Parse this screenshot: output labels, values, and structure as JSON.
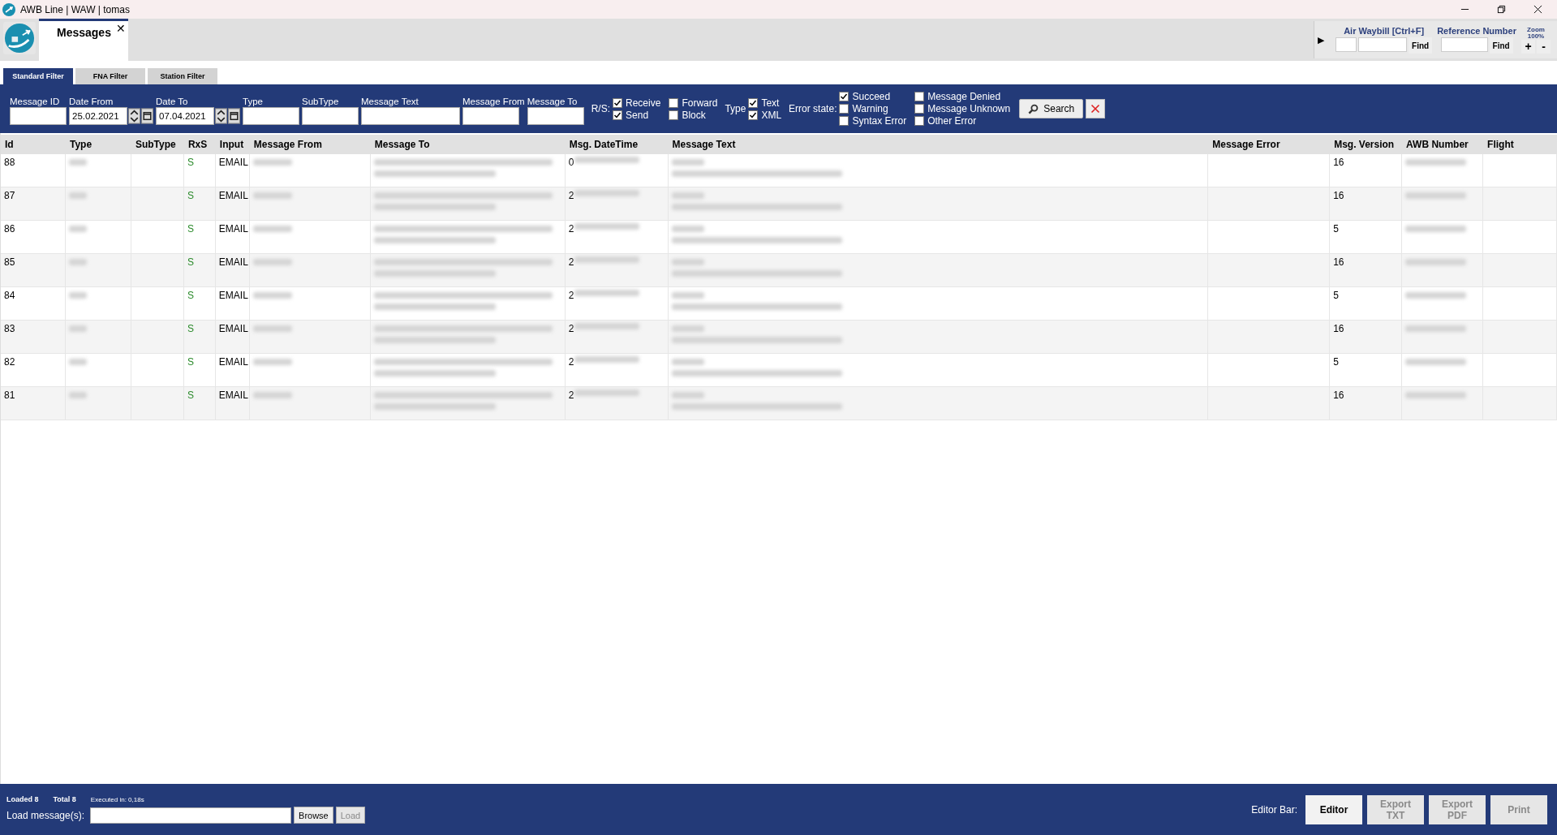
{
  "window": {
    "title": "AWB Line | WAW | tomas"
  },
  "doc_tabs": [
    {
      "label": "Messages",
      "close": "✕",
      "selected": true
    }
  ],
  "quick_search": {
    "expand": "▶",
    "awb_label": "Air Waybill [Ctrl+F]",
    "awb_find": "Find",
    "ref_label": "Reference Number",
    "ref_find": "Find",
    "zoom_label": "Zoom",
    "zoom_value": "100%",
    "zoom_in": "+",
    "zoom_out": "-"
  },
  "filter_tabs": [
    {
      "label": "Standard Filter",
      "selected": true
    },
    {
      "label": "FNA Filter",
      "selected": false
    },
    {
      "label": "Station Filter",
      "selected": false
    }
  ],
  "fields": [
    {
      "kind": "text",
      "label": "Message ID"
    },
    {
      "kind": "date",
      "label": "Date From",
      "value": "25.02.2021"
    },
    {
      "kind": "date",
      "label": "Date To",
      "value": "07.04.2021"
    },
    {
      "kind": "text",
      "label": "Type"
    },
    {
      "kind": "text",
      "label": "SubType"
    },
    {
      "kind": "wide",
      "label": "Message Text"
    },
    {
      "kind": "text",
      "label": "Message From"
    },
    {
      "kind": "text",
      "label": "Message To"
    }
  ],
  "rs": {
    "label": "R/S:",
    "options": [
      {
        "label": "Receive",
        "checked": true
      },
      {
        "label": "Send",
        "checked": true
      },
      {
        "label": "Forward",
        "checked": false
      },
      {
        "label": "Block",
        "checked": false
      }
    ]
  },
  "type_filter": {
    "label": "Type",
    "options": [
      {
        "label": "Text",
        "checked": true
      },
      {
        "label": "XML",
        "checked": true
      }
    ]
  },
  "error_state": {
    "label": "Error state:",
    "options": [
      {
        "label": "Succeed",
        "checked": true
      },
      {
        "label": "Warning",
        "checked": false
      },
      {
        "label": "Syntax Error",
        "checked": false
      },
      {
        "label": "Message Denied",
        "checked": false
      },
      {
        "label": "Message Unknown",
        "checked": false
      },
      {
        "label": "Other Error",
        "checked": false
      }
    ]
  },
  "search_button": "Search",
  "table": {
    "columns": [
      "Id",
      "Type",
      "SubType",
      "RxS",
      "Input",
      "Message From",
      "Message To",
      "Msg. DateTime",
      "Message Text",
      "Message Error",
      "Msg. Version",
      "AWB Number",
      "Flight"
    ],
    "rows": [
      {
        "id": "88",
        "rxs": "S",
        "input": "EMAIL",
        "datetime_visible": "0",
        "version": "16"
      },
      {
        "id": "87",
        "rxs": "S",
        "input": "EMAIL",
        "datetime_visible": "2",
        "version": "16"
      },
      {
        "id": "86",
        "rxs": "S",
        "input": "EMAIL",
        "datetime_visible": "2",
        "version": "5"
      },
      {
        "id": "85",
        "rxs": "S",
        "input": "EMAIL",
        "datetime_visible": "2",
        "version": "16"
      },
      {
        "id": "84",
        "rxs": "S",
        "input": "EMAIL",
        "datetime_visible": "2",
        "version": "5"
      },
      {
        "id": "83",
        "rxs": "S",
        "input": "EMAIL",
        "datetime_visible": "2",
        "version": "16"
      },
      {
        "id": "82",
        "rxs": "S",
        "input": "EMAIL",
        "datetime_visible": "2",
        "version": "5"
      },
      {
        "id": "81",
        "rxs": "S",
        "input": "EMAIL",
        "datetime_visible": "2",
        "version": "16"
      }
    ]
  },
  "status": {
    "loaded": "Loaded 8",
    "total": "Total 8",
    "executed": "Executed in: 0,18s",
    "load_label": "Load message(s):",
    "browse": "Browse",
    "load": "Load",
    "load_disabled": true
  },
  "editor_bar": {
    "label": "Editor Bar:",
    "buttons": [
      {
        "label": "Editor",
        "disabled": false
      },
      {
        "label": "Export TXT",
        "disabled": true
      },
      {
        "label": "Export PDF",
        "disabled": true
      },
      {
        "label": "Print",
        "disabled": true
      }
    ]
  }
}
